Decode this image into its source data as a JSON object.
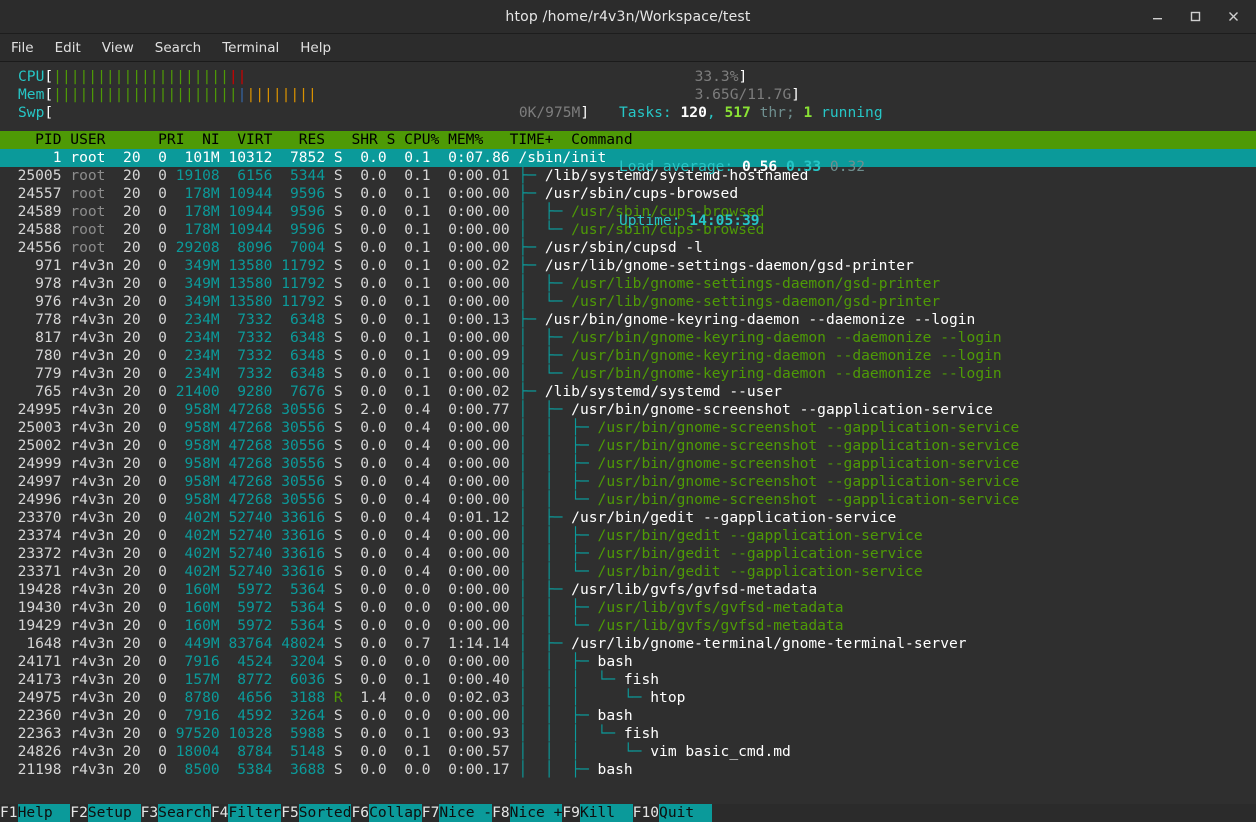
{
  "window": {
    "title": "htop /home/r4v3n/Workspace/test",
    "buttons": [
      {
        "name": "minimize-button",
        "glyph": "_"
      },
      {
        "name": "maximize-button",
        "glyph": "□"
      },
      {
        "name": "close-button",
        "glyph": "✕"
      }
    ]
  },
  "menubar": {
    "items": [
      "File",
      "Edit",
      "View",
      "Search",
      "Terminal",
      "Help"
    ]
  },
  "meters": {
    "cpu": {
      "label": "CPU",
      "open": "[",
      "close": "]",
      "value": "33.3%",
      "bar_green": "||||||||||||||||||||",
      "bar_red": "||",
      "bar_blank": "                                                   "
    },
    "mem": {
      "label": "Mem",
      "open": "[",
      "close": "]",
      "value": "3.65G/11.7G",
      "bar_green": "|||||||||||||||||||||",
      "bar_blue": "|",
      "bar_orange": "||||||||",
      "bar_blank": "                                           "
    },
    "swp": {
      "label": "Swp",
      "open": "[",
      "close": "]",
      "value": "0K/975M",
      "bar_blank": "                                                     "
    }
  },
  "stats": {
    "tasks_label": "Tasks: ",
    "tasks_count": "120",
    "tasks_sep": ", ",
    "thr_count": "517",
    "thr_label": " thr; ",
    "running_count": "1",
    "running_label": " running",
    "load_label": "Load average: ",
    "load1": "0.56",
    "load2": "0.33",
    "load3": "0.32",
    "uptime_label": "Uptime: ",
    "uptime": "14:05:39"
  },
  "table": {
    "header": "    PID USER      PRI  NI  VIRT   RES   SHR S CPU% MEM%   TIME+  Command",
    "columns": [
      "PID",
      "USER",
      "PRI",
      "NI",
      "VIRT",
      "RES",
      "SHR",
      "S",
      "CPU%",
      "MEM%",
      "TIME+",
      "Command"
    ],
    "rows": [
      {
        "pid": "      1",
        "user": "root ",
        "pri": " 20",
        "ni": "  0",
        "virt": " 101M",
        "res": "10312",
        "shr": " 7852",
        "s": "S",
        "cpu": "  0.0",
        "mem": "  0.1",
        "time": "  0:07.86",
        "tree": "",
        "cmd": "/sbin/init",
        "thread": false,
        "selected": true
      },
      {
        "pid": "  25005",
        "user": "root ",
        "pri": " 20",
        "ni": "  0",
        "virt": "19108",
        "res": " 6156",
        "shr": " 5344",
        "s": "S",
        "cpu": "  0.0",
        "mem": "  0.1",
        "time": "  0:00.01",
        "tree": "├─ ",
        "cmd": "/lib/systemd/systemd-hostnamed",
        "thread": false,
        "selected": false
      },
      {
        "pid": "  24557",
        "user": "root ",
        "pri": " 20",
        "ni": "  0",
        "virt": " 178M",
        "res": "10944",
        "shr": " 9596",
        "s": "S",
        "cpu": "  0.0",
        "mem": "  0.1",
        "time": "  0:00.00",
        "tree": "├─ ",
        "cmd": "/usr/sbin/cups-browsed",
        "thread": false,
        "selected": false
      },
      {
        "pid": "  24589",
        "user": "root ",
        "pri": " 20",
        "ni": "  0",
        "virt": " 178M",
        "res": "10944",
        "shr": " 9596",
        "s": "S",
        "cpu": "  0.0",
        "mem": "  0.1",
        "time": "  0:00.00",
        "tree": "│  ├─ ",
        "cmd": "/usr/sbin/cups-browsed",
        "thread": true,
        "selected": false
      },
      {
        "pid": "  24588",
        "user": "root ",
        "pri": " 20",
        "ni": "  0",
        "virt": " 178M",
        "res": "10944",
        "shr": " 9596",
        "s": "S",
        "cpu": "  0.0",
        "mem": "  0.1",
        "time": "  0:00.00",
        "tree": "│  └─ ",
        "cmd": "/usr/sbin/cups-browsed",
        "thread": true,
        "selected": false
      },
      {
        "pid": "  24556",
        "user": "root ",
        "pri": " 20",
        "ni": "  0",
        "virt": "29208",
        "res": " 8096",
        "shr": " 7004",
        "s": "S",
        "cpu": "  0.0",
        "mem": "  0.1",
        "time": "  0:00.00",
        "tree": "├─ ",
        "cmd": "/usr/sbin/cupsd -l",
        "thread": false,
        "selected": false
      },
      {
        "pid": "    971",
        "user": "r4v3n",
        "pri": " 20",
        "ni": "  0",
        "virt": " 349M",
        "res": "13580",
        "shr": "11792",
        "s": "S",
        "cpu": "  0.0",
        "mem": "  0.1",
        "time": "  0:00.02",
        "tree": "├─ ",
        "cmd": "/usr/lib/gnome-settings-daemon/gsd-printer",
        "thread": false,
        "selected": false
      },
      {
        "pid": "    978",
        "user": "r4v3n",
        "pri": " 20",
        "ni": "  0",
        "virt": " 349M",
        "res": "13580",
        "shr": "11792",
        "s": "S",
        "cpu": "  0.0",
        "mem": "  0.1",
        "time": "  0:00.00",
        "tree": "│  ├─ ",
        "cmd": "/usr/lib/gnome-settings-daemon/gsd-printer",
        "thread": true,
        "selected": false
      },
      {
        "pid": "    976",
        "user": "r4v3n",
        "pri": " 20",
        "ni": "  0",
        "virt": " 349M",
        "res": "13580",
        "shr": "11792",
        "s": "S",
        "cpu": "  0.0",
        "mem": "  0.1",
        "time": "  0:00.00",
        "tree": "│  └─ ",
        "cmd": "/usr/lib/gnome-settings-daemon/gsd-printer",
        "thread": true,
        "selected": false
      },
      {
        "pid": "    778",
        "user": "r4v3n",
        "pri": " 20",
        "ni": "  0",
        "virt": " 234M",
        "res": " 7332",
        "shr": " 6348",
        "s": "S",
        "cpu": "  0.0",
        "mem": "  0.1",
        "time": "  0:00.13",
        "tree": "├─ ",
        "cmd": "/usr/bin/gnome-keyring-daemon --daemonize --login",
        "thread": false,
        "selected": false
      },
      {
        "pid": "    817",
        "user": "r4v3n",
        "pri": " 20",
        "ni": "  0",
        "virt": " 234M",
        "res": " 7332",
        "shr": " 6348",
        "s": "S",
        "cpu": "  0.0",
        "mem": "  0.1",
        "time": "  0:00.00",
        "tree": "│  ├─ ",
        "cmd": "/usr/bin/gnome-keyring-daemon --daemonize --login",
        "thread": true,
        "selected": false
      },
      {
        "pid": "    780",
        "user": "r4v3n",
        "pri": " 20",
        "ni": "  0",
        "virt": " 234M",
        "res": " 7332",
        "shr": " 6348",
        "s": "S",
        "cpu": "  0.0",
        "mem": "  0.1",
        "time": "  0:00.09",
        "tree": "│  ├─ ",
        "cmd": "/usr/bin/gnome-keyring-daemon --daemonize --login",
        "thread": true,
        "selected": false
      },
      {
        "pid": "    779",
        "user": "r4v3n",
        "pri": " 20",
        "ni": "  0",
        "virt": " 234M",
        "res": " 7332",
        "shr": " 6348",
        "s": "S",
        "cpu": "  0.0",
        "mem": "  0.1",
        "time": "  0:00.00",
        "tree": "│  └─ ",
        "cmd": "/usr/bin/gnome-keyring-daemon --daemonize --login",
        "thread": true,
        "selected": false
      },
      {
        "pid": "    765",
        "user": "r4v3n",
        "pri": " 20",
        "ni": "  0",
        "virt": "21400",
        "res": " 9280",
        "shr": " 7676",
        "s": "S",
        "cpu": "  0.0",
        "mem": "  0.1",
        "time": "  0:00.02",
        "tree": "├─ ",
        "cmd": "/lib/systemd/systemd --user",
        "thread": false,
        "selected": false
      },
      {
        "pid": "  24995",
        "user": "r4v3n",
        "pri": " 20",
        "ni": "  0",
        "virt": " 958M",
        "res": "47268",
        "shr": "30556",
        "s": "S",
        "cpu": "  2.0",
        "mem": "  0.4",
        "time": "  0:00.77",
        "tree": "│  ├─ ",
        "cmd": "/usr/bin/gnome-screenshot --gapplication-service",
        "thread": false,
        "selected": false
      },
      {
        "pid": "  25003",
        "user": "r4v3n",
        "pri": " 20",
        "ni": "  0",
        "virt": " 958M",
        "res": "47268",
        "shr": "30556",
        "s": "S",
        "cpu": "  0.0",
        "mem": "  0.4",
        "time": "  0:00.00",
        "tree": "│  │  ├─ ",
        "cmd": "/usr/bin/gnome-screenshot --gapplication-service",
        "thread": true,
        "selected": false
      },
      {
        "pid": "  25002",
        "user": "r4v3n",
        "pri": " 20",
        "ni": "  0",
        "virt": " 958M",
        "res": "47268",
        "shr": "30556",
        "s": "S",
        "cpu": "  0.0",
        "mem": "  0.4",
        "time": "  0:00.00",
        "tree": "│  │  ├─ ",
        "cmd": "/usr/bin/gnome-screenshot --gapplication-service",
        "thread": true,
        "selected": false
      },
      {
        "pid": "  24999",
        "user": "r4v3n",
        "pri": " 20",
        "ni": "  0",
        "virt": " 958M",
        "res": "47268",
        "shr": "30556",
        "s": "S",
        "cpu": "  0.0",
        "mem": "  0.4",
        "time": "  0:00.00",
        "tree": "│  │  ├─ ",
        "cmd": "/usr/bin/gnome-screenshot --gapplication-service",
        "thread": true,
        "selected": false
      },
      {
        "pid": "  24997",
        "user": "r4v3n",
        "pri": " 20",
        "ni": "  0",
        "virt": " 958M",
        "res": "47268",
        "shr": "30556",
        "s": "S",
        "cpu": "  0.0",
        "mem": "  0.4",
        "time": "  0:00.00",
        "tree": "│  │  ├─ ",
        "cmd": "/usr/bin/gnome-screenshot --gapplication-service",
        "thread": true,
        "selected": false
      },
      {
        "pid": "  24996",
        "user": "r4v3n",
        "pri": " 20",
        "ni": "  0",
        "virt": " 958M",
        "res": "47268",
        "shr": "30556",
        "s": "S",
        "cpu": "  0.0",
        "mem": "  0.4",
        "time": "  0:00.00",
        "tree": "│  │  └─ ",
        "cmd": "/usr/bin/gnome-screenshot --gapplication-service",
        "thread": true,
        "selected": false
      },
      {
        "pid": "  23370",
        "user": "r4v3n",
        "pri": " 20",
        "ni": "  0",
        "virt": " 402M",
        "res": "52740",
        "shr": "33616",
        "s": "S",
        "cpu": "  0.0",
        "mem": "  0.4",
        "time": "  0:01.12",
        "tree": "│  ├─ ",
        "cmd": "/usr/bin/gedit --gapplication-service",
        "thread": false,
        "selected": false
      },
      {
        "pid": "  23374",
        "user": "r4v3n",
        "pri": " 20",
        "ni": "  0",
        "virt": " 402M",
        "res": "52740",
        "shr": "33616",
        "s": "S",
        "cpu": "  0.0",
        "mem": "  0.4",
        "time": "  0:00.00",
        "tree": "│  │  ├─ ",
        "cmd": "/usr/bin/gedit --gapplication-service",
        "thread": true,
        "selected": false
      },
      {
        "pid": "  23372",
        "user": "r4v3n",
        "pri": " 20",
        "ni": "  0",
        "virt": " 402M",
        "res": "52740",
        "shr": "33616",
        "s": "S",
        "cpu": "  0.0",
        "mem": "  0.4",
        "time": "  0:00.00",
        "tree": "│  │  ├─ ",
        "cmd": "/usr/bin/gedit --gapplication-service",
        "thread": true,
        "selected": false
      },
      {
        "pid": "  23371",
        "user": "r4v3n",
        "pri": " 20",
        "ni": "  0",
        "virt": " 402M",
        "res": "52740",
        "shr": "33616",
        "s": "S",
        "cpu": "  0.0",
        "mem": "  0.4",
        "time": "  0:00.00",
        "tree": "│  │  └─ ",
        "cmd": "/usr/bin/gedit --gapplication-service",
        "thread": true,
        "selected": false
      },
      {
        "pid": "  19428",
        "user": "r4v3n",
        "pri": " 20",
        "ni": "  0",
        "virt": " 160M",
        "res": " 5972",
        "shr": " 5364",
        "s": "S",
        "cpu": "  0.0",
        "mem": "  0.0",
        "time": "  0:00.00",
        "tree": "│  ├─ ",
        "cmd": "/usr/lib/gvfs/gvfsd-metadata",
        "thread": false,
        "selected": false
      },
      {
        "pid": "  19430",
        "user": "r4v3n",
        "pri": " 20",
        "ni": "  0",
        "virt": " 160M",
        "res": " 5972",
        "shr": " 5364",
        "s": "S",
        "cpu": "  0.0",
        "mem": "  0.0",
        "time": "  0:00.00",
        "tree": "│  │  ├─ ",
        "cmd": "/usr/lib/gvfs/gvfsd-metadata",
        "thread": true,
        "selected": false
      },
      {
        "pid": "  19429",
        "user": "r4v3n",
        "pri": " 20",
        "ni": "  0",
        "virt": " 160M",
        "res": " 5972",
        "shr": " 5364",
        "s": "S",
        "cpu": "  0.0",
        "mem": "  0.0",
        "time": "  0:00.00",
        "tree": "│  │  └─ ",
        "cmd": "/usr/lib/gvfs/gvfsd-metadata",
        "thread": true,
        "selected": false
      },
      {
        "pid": "   1648",
        "user": "r4v3n",
        "pri": " 20",
        "ni": "  0",
        "virt": " 449M",
        "res": "83764",
        "shr": "48024",
        "s": "S",
        "cpu": "  0.0",
        "mem": "  0.7",
        "time": "  1:14.14",
        "tree": "│  ├─ ",
        "cmd": "/usr/lib/gnome-terminal/gnome-terminal-server",
        "thread": false,
        "selected": false
      },
      {
        "pid": "  24171",
        "user": "r4v3n",
        "pri": " 20",
        "ni": "  0",
        "virt": " 7916",
        "res": " 4524",
        "shr": " 3204",
        "s": "S",
        "cpu": "  0.0",
        "mem": "  0.0",
        "time": "  0:00.00",
        "tree": "│  │  ├─ ",
        "cmd": "bash",
        "thread": false,
        "selected": false
      },
      {
        "pid": "  24173",
        "user": "r4v3n",
        "pri": " 20",
        "ni": "  0",
        "virt": " 157M",
        "res": " 8772",
        "shr": " 6036",
        "s": "S",
        "cpu": "  0.0",
        "mem": "  0.1",
        "time": "  0:00.40",
        "tree": "│  │  │  └─ ",
        "cmd": "fish",
        "thread": false,
        "selected": false
      },
      {
        "pid": "  24975",
        "user": "r4v3n",
        "pri": " 20",
        "ni": "  0",
        "virt": " 8780",
        "res": " 4656",
        "shr": " 3188",
        "s": "R",
        "cpu": "  1.4",
        "mem": "  0.0",
        "time": "  0:02.03",
        "tree": "│  │  │     └─ ",
        "cmd": "htop",
        "thread": false,
        "selected": false
      },
      {
        "pid": "  22360",
        "user": "r4v3n",
        "pri": " 20",
        "ni": "  0",
        "virt": " 7916",
        "res": " 4592",
        "shr": " 3264",
        "s": "S",
        "cpu": "  0.0",
        "mem": "  0.0",
        "time": "  0:00.00",
        "tree": "│  │  ├─ ",
        "cmd": "bash",
        "thread": false,
        "selected": false
      },
      {
        "pid": "  22363",
        "user": "r4v3n",
        "pri": " 20",
        "ni": "  0",
        "virt": "97520",
        "res": "10328",
        "shr": " 5988",
        "s": "S",
        "cpu": "  0.0",
        "mem": "  0.1",
        "time": "  0:00.93",
        "tree": "│  │  │  └─ ",
        "cmd": "fish",
        "thread": false,
        "selected": false
      },
      {
        "pid": "  24826",
        "user": "r4v3n",
        "pri": " 20",
        "ni": "  0",
        "virt": "18004",
        "res": " 8784",
        "shr": " 5148",
        "s": "S",
        "cpu": "  0.0",
        "mem": "  0.1",
        "time": "  0:00.57",
        "tree": "│  │  │     └─ ",
        "cmd": "vim basic_cmd.md",
        "thread": false,
        "selected": false
      },
      {
        "pid": "  21198",
        "user": "r4v3n",
        "pri": " 20",
        "ni": "  0",
        "virt": " 8500",
        "res": " 5384",
        "shr": " 3688",
        "s": "S",
        "cpu": "  0.0",
        "mem": "  0.0",
        "time": "  0:00.17",
        "tree": "│  │  ├─ ",
        "cmd": "bash",
        "thread": false,
        "selected": false
      }
    ]
  },
  "functionbar": [
    {
      "key": "F1",
      "label": "Help  "
    },
    {
      "key": "F2",
      "label": "Setup "
    },
    {
      "key": "F3",
      "label": "Search"
    },
    {
      "key": "F4",
      "label": "Filter"
    },
    {
      "key": "F5",
      "label": "Sorted"
    },
    {
      "key": "F6",
      "label": "Collap"
    },
    {
      "key": "F7",
      "label": "Nice -"
    },
    {
      "key": "F8",
      "label": "Nice +"
    },
    {
      "key": "F9",
      "label": "Kill  "
    },
    {
      "key": "F10",
      "label": "Quit  "
    }
  ],
  "colors": {
    "accent_green": "#4e9a06",
    "accent_cyan": "#0b9a9a",
    "red": "#cc0000",
    "orange": "#d99100",
    "blue": "#3465a4",
    "terminal_bg": "#2f2f2f",
    "titlebar_bg": "#2c2c2c"
  }
}
